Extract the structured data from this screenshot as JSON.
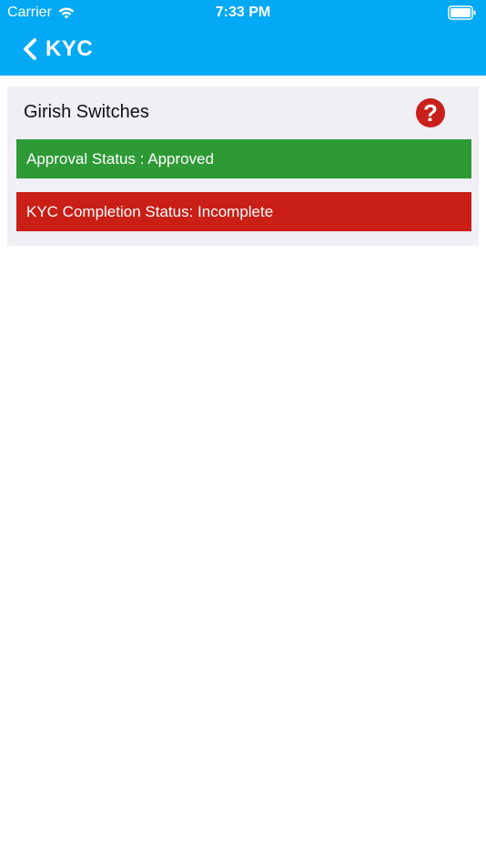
{
  "status_bar": {
    "carrier": "Carrier",
    "time": "7:33 PM",
    "wifi_icon": "wifi-icon",
    "battery_icon": "battery-icon"
  },
  "nav": {
    "back_icon": "chevron-left-icon",
    "title": "KYC"
  },
  "card": {
    "title": "Girish Switches",
    "help_icon": "question-icon",
    "help_glyph": "?",
    "approval_status": "Approval Status : Approved",
    "kyc_status": "KYC Completion Status: Incomplete"
  },
  "colors": {
    "header": "#03a9f4",
    "card_bg": "#efeff4",
    "approved": "#2e9a36",
    "incomplete": "#c91f16",
    "help": "#c9201b"
  }
}
